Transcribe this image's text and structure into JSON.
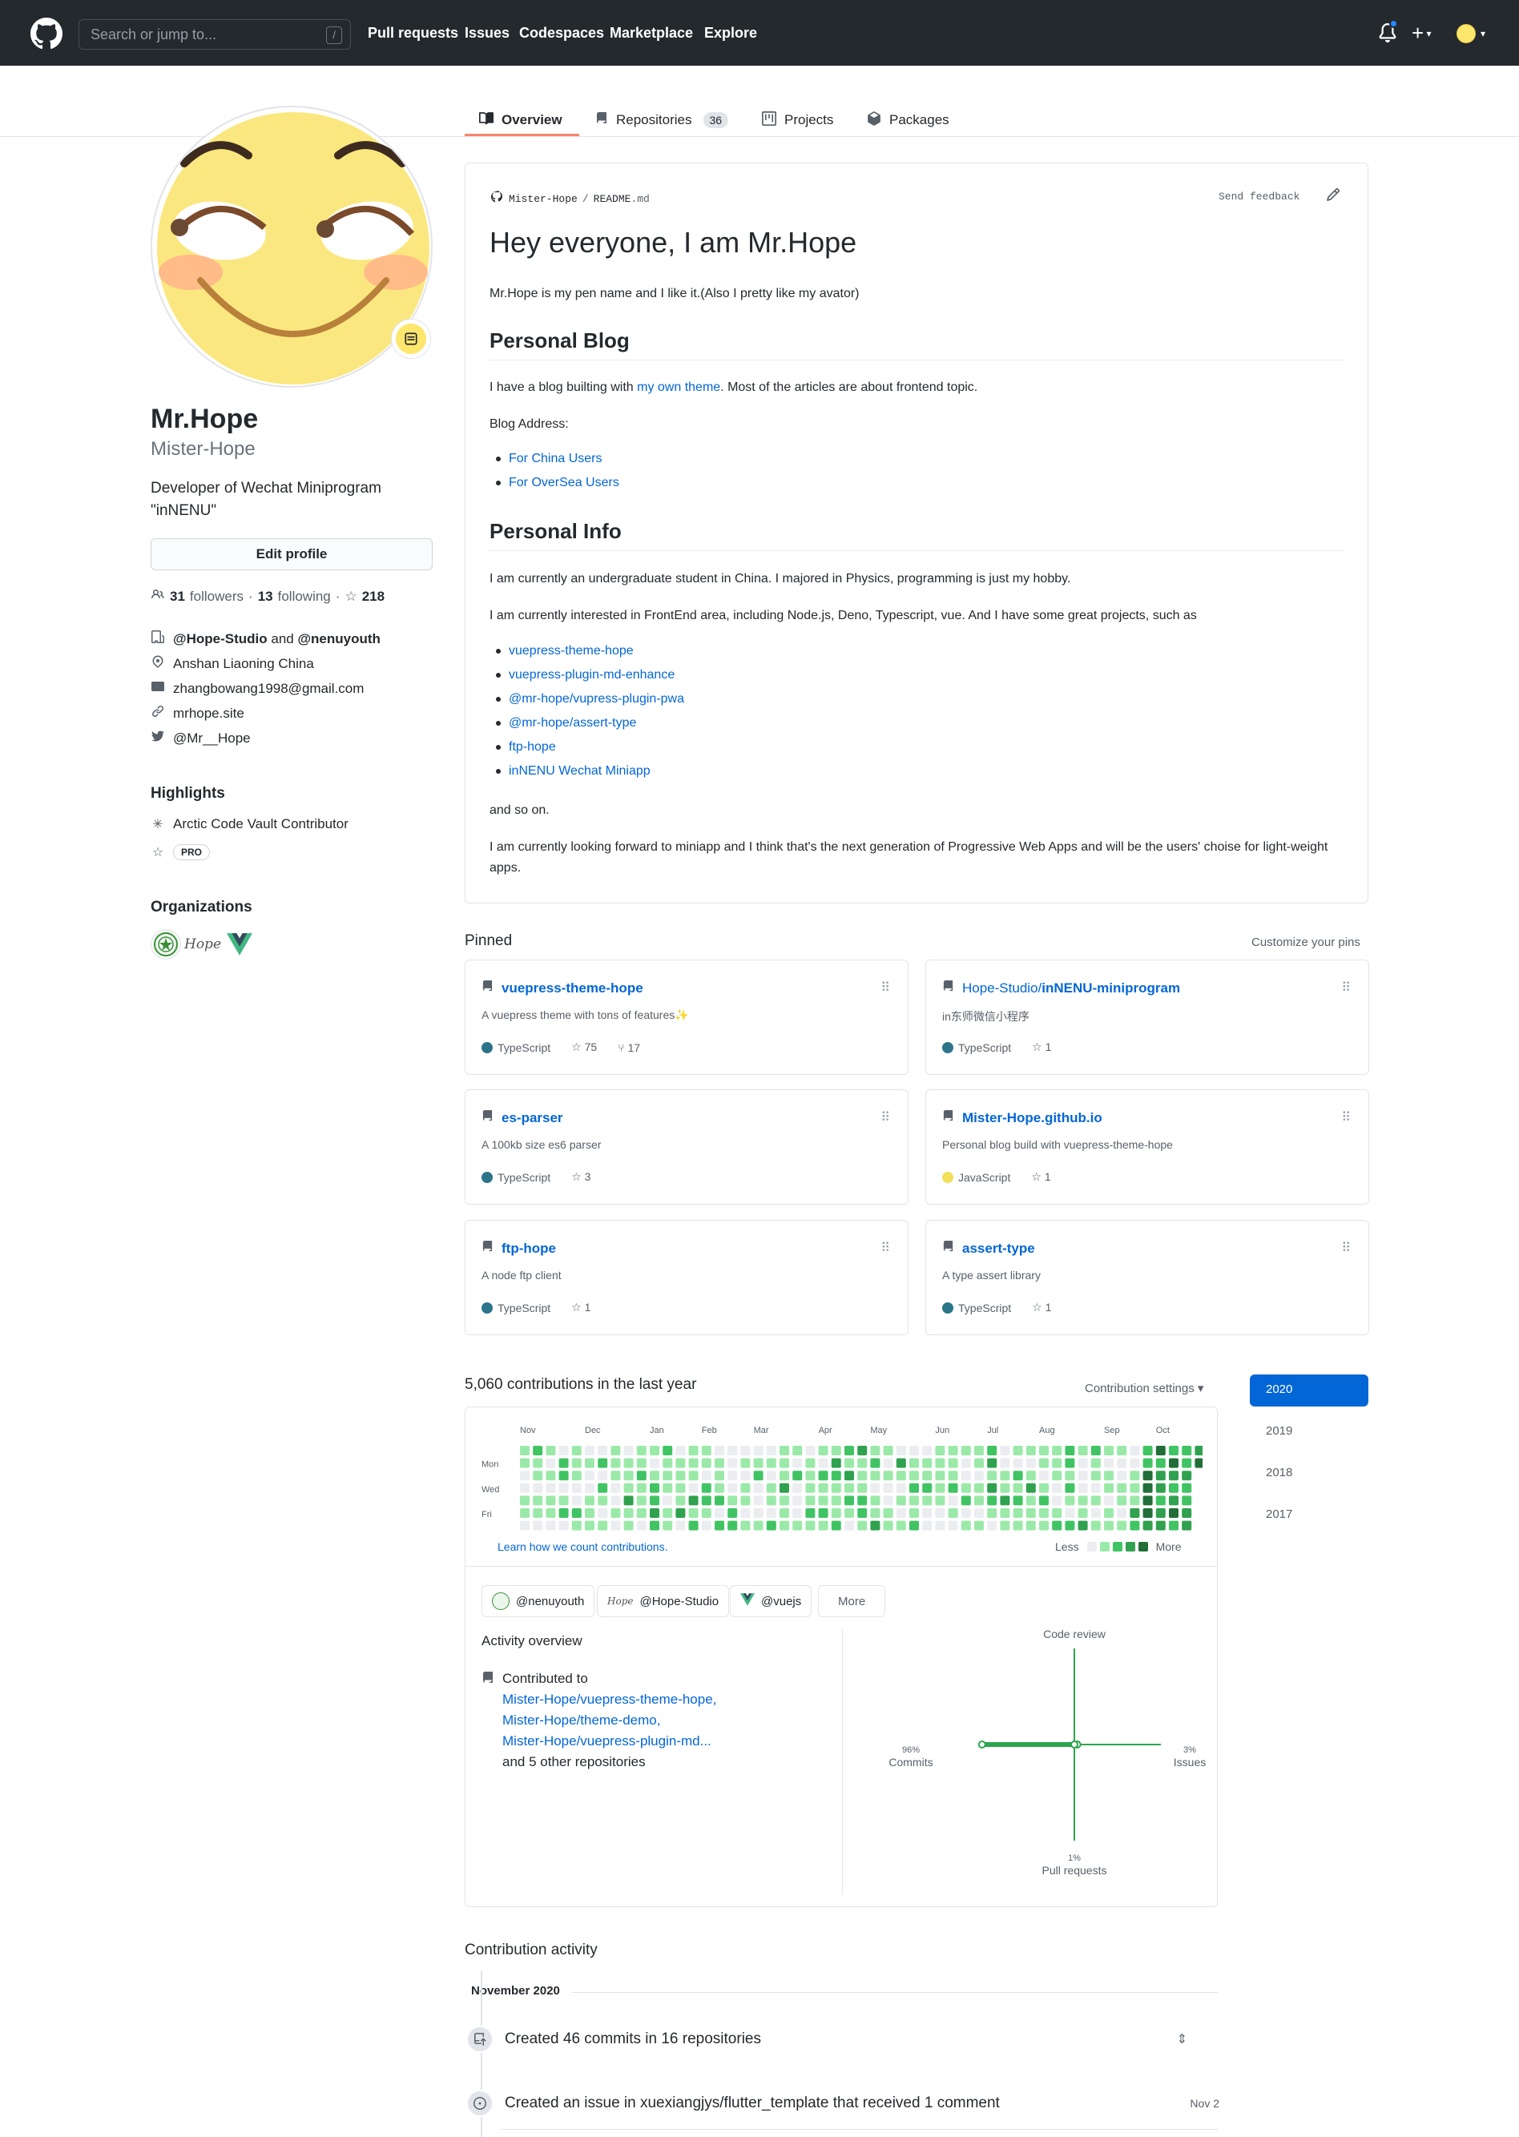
{
  "header": {
    "search_placeholder": "Search or jump to...",
    "search_shortcut": "/",
    "nav": [
      "Pull requests",
      "Issues",
      "Codespaces",
      "Marketplace",
      "Explore"
    ],
    "icons": [
      "github-logo",
      "bell-icon",
      "plus-icon",
      "avatar"
    ]
  },
  "tabs": [
    {
      "label": "Overview",
      "icon": "book-icon",
      "selected": true
    },
    {
      "label": "Repositories",
      "icon": "repo-icon",
      "count": "36"
    },
    {
      "label": "Projects",
      "icon": "project-icon"
    },
    {
      "label": "Packages",
      "icon": "package-icon"
    }
  ],
  "profile": {
    "name": "Mr.Hope",
    "username": "Mister-Hope",
    "bio": "Developer of Wechat Miniprogram \"inNENU\"",
    "edit_label": "Edit profile",
    "followers": "31",
    "followers_label": "followers",
    "following": "13",
    "following_label": "following",
    "stars": "218",
    "org_text_a": "@Hope-Studio",
    "org_text_and": "and",
    "org_text_b": "@nenuyouth",
    "location": "Anshan Liaoning China",
    "email": "zhangbowang1998@gmail.com",
    "website": "mrhope.site",
    "twitter": "@Mr__Hope",
    "highlights_title": "Highlights",
    "highlight_vault": "Arctic Code Vault Contributor",
    "highlight_pro": "PRO",
    "orgs_title": "Organizations"
  },
  "readme": {
    "crumb_user": "Mister-Hope",
    "crumb_sep": "/",
    "crumb_file": "README",
    "crumb_ext": ".md",
    "send_feedback": "Send feedback",
    "h1": "Hey everyone, I am Mr.Hope",
    "intro": "Mr.Hope is my pen name and I like it.(Also I pretty like my avator)",
    "h2_blog": "Personal Blog",
    "blog_text_pre": "I have a blog builting with ",
    "blog_link": "my own theme",
    "blog_text_post": ". Most of the articles are about frontend topic.",
    "blog_address": "Blog Address:",
    "blog_links": [
      "For China Users",
      "For OverSea Users"
    ],
    "h2_info": "Personal Info",
    "info_1": "I am currently an undergraduate student in China. I majored in Physics, programming is just my hobby.",
    "info_2": "I am currently interested in FrontEnd area, including Node.js, Deno, Typescript, vue. And I have some great projects, such as",
    "projects": [
      "vuepress-theme-hope",
      "vuepress-plugin-md-enhance",
      "@mr-hope/vupress-plugin-pwa",
      "@mr-hope/assert-type",
      "ftp-hope",
      "inNENU Wechat Miniapp"
    ],
    "and_so_on": "and so on.",
    "closing": "I am currently looking forward to miniapp and I think that's the next generation of Progressive Web Apps and will be the users' choise for light-weight apps."
  },
  "pinned": {
    "title": "Pinned",
    "customize": "Customize your pins",
    "repos": [
      {
        "owner": "",
        "name": "vuepress-theme-hope",
        "desc": "A vuepress theme with tons of features",
        "desc_emoji": "✨",
        "lang": "TypeScript",
        "lang_color": "#2b7489",
        "stars": "75",
        "forks": "17"
      },
      {
        "owner": "Hope-Studio/",
        "name": "inNENU-miniprogram",
        "desc": "in东师微信小程序",
        "lang": "TypeScript",
        "lang_color": "#2b7489",
        "stars": "1",
        "forks": ""
      },
      {
        "owner": "",
        "name": "es-parser",
        "desc": "A 100kb size es6 parser",
        "lang": "TypeScript",
        "lang_color": "#2b7489",
        "stars": "3",
        "forks": ""
      },
      {
        "owner": "",
        "name": "Mister-Hope.github.io",
        "desc": "Personal blog build with vuepress-theme-hope",
        "lang": "JavaScript",
        "lang_color": "#f1e05a",
        "stars": "1",
        "forks": ""
      },
      {
        "owner": "",
        "name": "ftp-hope",
        "desc": "A node ftp client",
        "lang": "TypeScript",
        "lang_color": "#2b7489",
        "stars": "1",
        "forks": ""
      },
      {
        "owner": "",
        "name": "assert-type",
        "desc": "A type assert library",
        "lang": "TypeScript",
        "lang_color": "#2b7489",
        "stars": "1",
        "forks": ""
      }
    ]
  },
  "contributions": {
    "title": "5,060 contributions in the last year",
    "settings": "Contribution settings ▾",
    "months": [
      "Nov",
      "Dec",
      "Jan",
      "Feb",
      "Mar",
      "Apr",
      "May",
      "Jun",
      "Jul",
      "Aug",
      "Sep",
      "Oct"
    ],
    "weekdays": [
      "Mon",
      "Wed",
      "Fri"
    ],
    "learn": "Learn how we count contributions.",
    "less": "Less",
    "more": "More",
    "colors": [
      "#ebedf0",
      "#9be9a8",
      "#40c463",
      "#30a14e",
      "#216e39"
    ],
    "years": [
      "2020",
      "2019",
      "2018",
      "2017"
    ],
    "org_chips": [
      "@nenuyouth",
      "@Hope-Studio",
      "@vuejs"
    ],
    "more_chip": "More",
    "activity_title": "Activity overview",
    "contributed_to": "Contributed to",
    "contributed_repos": [
      "Mister-Hope/vuepress-theme-hope,",
      "Mister-Hope/theme-demo,",
      "Mister-Hope/vuepress-plugin-md..."
    ],
    "and_other": "and 5 other repositories",
    "axes": {
      "top": "Code review",
      "left_pct": "96%",
      "left_label": "Commits",
      "right_pct": "3%",
      "right_label": "Issues",
      "bottom_pct": "1%",
      "bottom_label": "Pull requests",
      "commits": 96,
      "issues": 3,
      "pull_requests": 1,
      "code_review": 0
    }
  },
  "activity": {
    "title": "Contribution activity",
    "month": "November 2020",
    "item_commits": "Created 46 commits in 16 repositories",
    "item_issue": "Created an issue in xuexiangjys/flutter_template that received 1 comment",
    "item_issue_date": "Nov 2"
  }
}
